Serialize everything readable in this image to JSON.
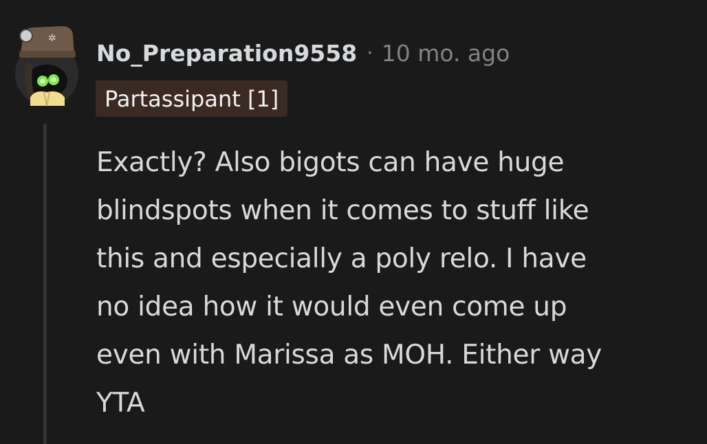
{
  "comment": {
    "author": "No_Preparation9558",
    "separator": "·",
    "timestamp": "10 mo. ago",
    "flair": "Partassipant [1]",
    "avatar_icon": "snoo-avatar-icon",
    "body_lines": [
      "Exactly? Also bigots can have huge",
      "blindspots when it comes to stuff like",
      "this and especially a poly relo. I have",
      "no idea how it would even come up",
      "even with Marissa as MOH. Either way",
      "YTA"
    ]
  },
  "colors": {
    "background": "#1a1a1b",
    "text": "#d7dadc",
    "muted": "#818384",
    "flair_bg": "#3b2a22",
    "thread_line": "#343536"
  }
}
